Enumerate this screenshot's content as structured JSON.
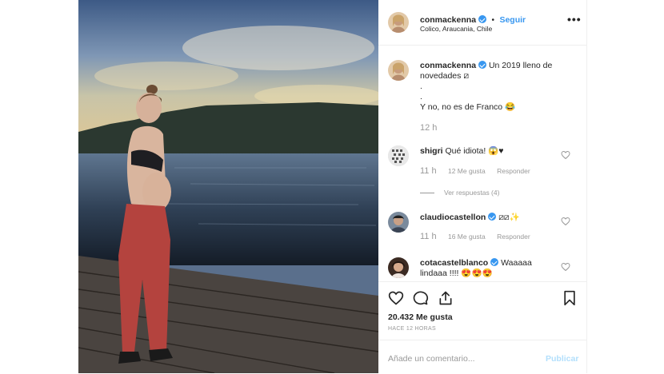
{
  "post": {
    "username": "conmackenna",
    "dot": "•",
    "follow_label": "Seguir",
    "location": "Colico, Araucania, Chile",
    "more_label": "•••",
    "caption_line1": "Un 2019 lleno de novedades",
    "caption_emoji": "⧄",
    "caption_dot1": ".",
    "caption_dot2": ".",
    "caption_line2": "Y no, no es de Franco 😂",
    "caption_time": "12 h"
  },
  "comments": [
    {
      "username": "shigri",
      "verified": false,
      "text": "Qué idiota! 😱♥",
      "time": "11 h",
      "likes": "12 Me gusta",
      "reply": "Responder"
    },
    {
      "username": "claudiocastellon",
      "verified": true,
      "text": "⧄⧄✨",
      "time": "11 h",
      "likes": "16 Me gusta",
      "reply": "Responder"
    },
    {
      "username": "cotacastelblanco",
      "verified": true,
      "text": "Waaaaa lindaaa !!!! 😍😍😍"
    }
  ],
  "view_replies": "Ver respuestas (4)",
  "likes_count": "20.432 Me gusta",
  "time_ago": "HACE 12 HORAS",
  "add_comment_placeholder": "Añade un comentario...",
  "publish_label": "Publicar",
  "colors": {
    "accent": "#3897f0",
    "publish_disabled": "#b2dffc",
    "muted": "#999999"
  },
  "icons": [
    "heart-icon",
    "comment-icon",
    "share-icon",
    "bookmark-icon",
    "verified-icon",
    "more-icon"
  ]
}
